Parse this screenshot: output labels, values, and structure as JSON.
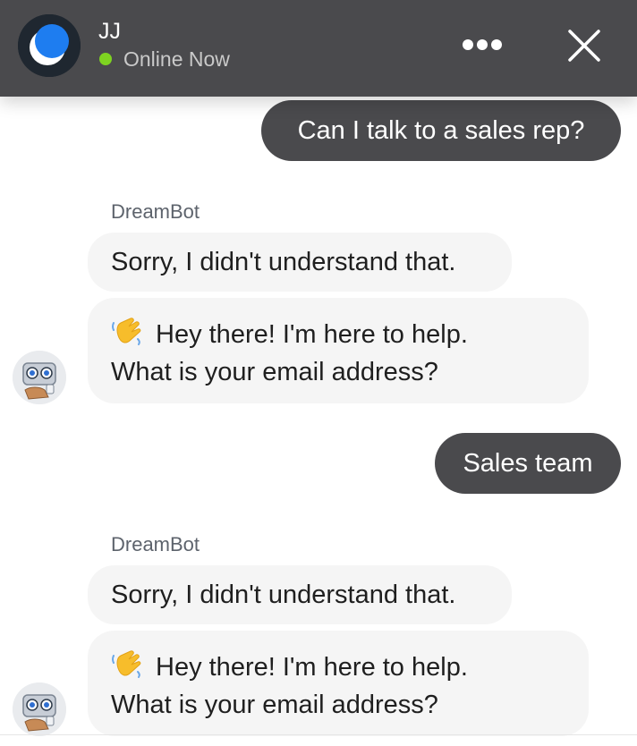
{
  "header": {
    "agent_name": "JJ",
    "status": "Online Now",
    "status_color": "#7ed321",
    "more_icon": "more-horizontal-icon",
    "close_icon": "close-icon",
    "logo_icon": "crescent-moon-icon"
  },
  "messages": [
    {
      "from": "user",
      "text": "Can I talk to a sales rep?"
    },
    {
      "from": "bot",
      "sender": "DreamBot",
      "text": "Sorry, I didn't understand that."
    },
    {
      "from": "bot",
      "line1": "Hey there! I'm here to help.",
      "line2": "What is your email address?",
      "emoji": "waving-hand-icon"
    },
    {
      "from": "user",
      "text": "Sales team"
    },
    {
      "from": "bot",
      "sender": "DreamBot",
      "text": "Sorry, I didn't understand that."
    },
    {
      "from": "bot",
      "line1": "Hey there! I'm here to help.",
      "line2": "What is your email address?",
      "emoji": "waving-hand-icon"
    }
  ],
  "colors": {
    "header_bg": "#4a4a4d",
    "user_bubble": "#4a4a4d",
    "bot_bubble": "#f5f5f5",
    "logo_accent": "#1e7df0"
  }
}
